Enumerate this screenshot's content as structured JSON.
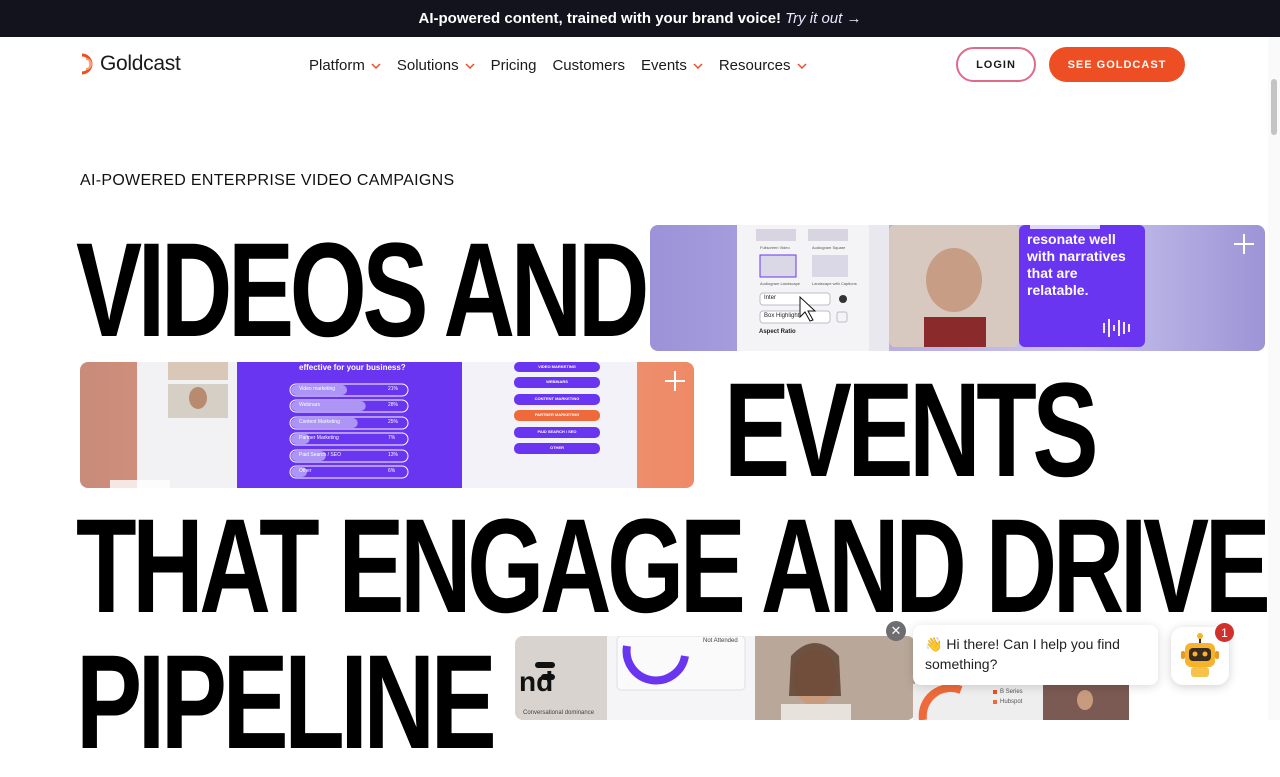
{
  "announcement": {
    "text": "AI-powered content, trained with your brand voice!",
    "link": "Try it out →"
  },
  "nav": {
    "logo_text": "Goldcast",
    "items": [
      {
        "label": "Platform",
        "dropdown": true
      },
      {
        "label": "Solutions",
        "dropdown": true
      },
      {
        "label": "Pricing",
        "dropdown": false
      },
      {
        "label": "Customers",
        "dropdown": false
      },
      {
        "label": "Events",
        "dropdown": true
      },
      {
        "label": "Resources",
        "dropdown": true
      }
    ],
    "login_label": "LOGIN",
    "cta_label": "SEE GOLDCAST"
  },
  "hero": {
    "eyebrow": "AI-POWERED ENTERPRISE VIDEO CAMPAIGNS",
    "line1": "VIDEOS AND",
    "line2": "EVENTS",
    "line3": "THAT ENGAGE AND DRIVE",
    "line4": "PIPELINE"
  },
  "card1": {
    "panel_labels": [
      "Fullscreen Video",
      "Audiogram Square",
      "Audiogram Landscape",
      "Landscape with Captions"
    ],
    "font_value": "Inter",
    "style_value": "Box Highlight",
    "aspect_label": "Aspect Ratio",
    "caption_text": "resonate well with narratives that are relatable."
  },
  "card2": {
    "poll_question": "effective for your business?",
    "poll_options": [
      {
        "label": "Video marketing",
        "pct": "21%",
        "fill": 0.21
      },
      {
        "label": "Webinars",
        "pct": "28%",
        "fill": 0.28
      },
      {
        "label": "Content Marketing",
        "pct": "25%",
        "fill": 0.25
      },
      {
        "label": "Partner Marketing",
        "pct": "7%",
        "fill": 0.07
      },
      {
        "label": "Paid Search / SEO",
        "pct": "13%",
        "fill": 0.13
      },
      {
        "label": "Other",
        "pct": "6%",
        "fill": 0.06
      }
    ],
    "choice_buttons": [
      "VIDEO MARKETING",
      "WEBINARS",
      "CONTENT MARKETING",
      "PARTNER MARKETING",
      "PAID SEARCH / SEO",
      "OTHER"
    ],
    "highlighted_choice": "PARTNER MARKETING"
  },
  "card3": {
    "badge_text": "Not Attended",
    "logo_partial": "nd",
    "caption_partial": "Conversational dominance"
  },
  "lower_right": {
    "legend": [
      "B Series",
      "Hubspot"
    ]
  },
  "chat": {
    "wave": "👋",
    "message": "Hi there! Can I help you find something?",
    "close": "✕",
    "unread_count": "1"
  },
  "colors": {
    "announcement_bg": "#12131c",
    "cta": "#ee4e23",
    "login_border": "#e06a8a",
    "purple": "#6a35f0"
  }
}
